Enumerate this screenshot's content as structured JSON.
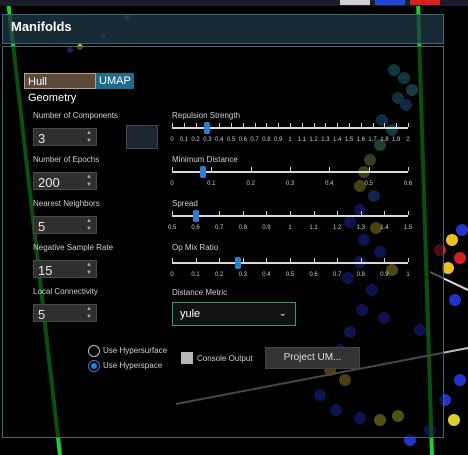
{
  "window": {
    "title": "Manifolds"
  },
  "tabs": [
    {
      "label": "Hull Geometry",
      "active": true
    },
    {
      "label": "UMAP",
      "active": false
    }
  ],
  "left_params": [
    {
      "label": "Number of Components",
      "value": "3"
    },
    {
      "label": "Number of Epochs",
      "value": "200"
    },
    {
      "label": "Nearest Neighbors",
      "value": "5"
    },
    {
      "label": "Negative Sample Rate",
      "value": "15"
    },
    {
      "label": "Local Connectivity",
      "value": "5"
    }
  ],
  "sliders": [
    {
      "label": "Repulsion Strength",
      "value": 0.3,
      "tick_labels": [
        "0",
        "0.1",
        "0.2",
        "0.3",
        "0.4",
        "0.5",
        "0.6",
        "0.7",
        "0.8",
        "0.9",
        "1",
        "1.1",
        "1.2",
        "1.3",
        "1.4",
        "1.5",
        "1.6",
        "1.7",
        "1.8",
        "1.9",
        "2"
      ]
    },
    {
      "label": "Minimum Distance",
      "value": 0.08,
      "tick_labels": [
        "0",
        "0.1",
        "0.2",
        "0.3",
        "0.4",
        "0.5",
        "0.6"
      ]
    },
    {
      "label": "Spread",
      "value": 0.6,
      "tick_labels": [
        "0.5",
        "0.6",
        "0.7",
        "0.8",
        "0.9",
        "1",
        "1.1",
        "1.2",
        "1.3",
        "1.4",
        "1.5"
      ]
    },
    {
      "label": "Op Mix Ratio",
      "value": 0.28,
      "tick_labels": [
        "0",
        "0.1",
        "0.2",
        "0.3",
        "0.4",
        "0.5",
        "0.6",
        "0.7",
        "0.8",
        "0.9",
        "1"
      ]
    }
  ],
  "distance_metric": {
    "label": "Distance Metric",
    "value": "yule"
  },
  "radios": [
    {
      "label": "Use Hypersurface",
      "checked": false
    },
    {
      "label": "Use Hyperspace",
      "checked": true
    }
  ],
  "console_output": {
    "label": "Console Output",
    "checked": false
  },
  "project_button": {
    "label": "Project UM..."
  },
  "icons": [
    "chevron-up-icon",
    "chevron-down-icon",
    "dropdown-chevron-icon",
    "minimap-icon"
  ],
  "colors": {
    "accent": "#2b7fd0",
    "panel_border": "#3b6a78",
    "header_bg": "#1e3440",
    "select_border": "#3c9a6a"
  }
}
